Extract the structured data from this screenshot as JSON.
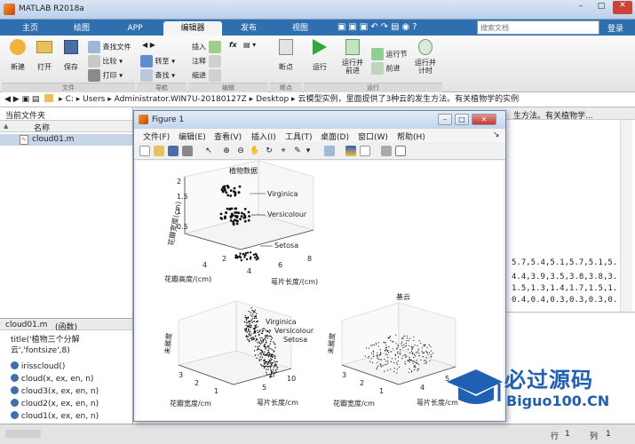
{
  "window": {
    "title": "MATLAB R2018a",
    "search_placeholder": "搜索文档",
    "login": "登录"
  },
  "tabs": [
    {
      "label": "主页"
    },
    {
      "label": "绘图"
    },
    {
      "label": "APP"
    },
    {
      "label": "编辑器"
    },
    {
      "label": "发布"
    },
    {
      "label": "视图"
    }
  ],
  "ribbon": {
    "new": "新建",
    "open": "打开",
    "save": "保存",
    "find_files": "查找文件",
    "compare": "比较",
    "print": "打印",
    "insert": "插入",
    "fx": "fx",
    "comment": "注释",
    "indent": "缩进",
    "goto": "转至",
    "find": "查找",
    "breakpoints": "断点",
    "run": "运行",
    "run_advance": "运行并\n前进",
    "run_section": "运行节",
    "advance": "前进",
    "run_time": "运行并\n计时",
    "groups": {
      "file": "文件",
      "navigate": "导航",
      "edit": "编辑",
      "breakpoints": "断点",
      "run": "运行"
    }
  },
  "address": {
    "parts": [
      "C:",
      "Users",
      "Administrator.WIN7U-20180127Z",
      "Desktop",
      "云模型实例，里面提供了3种云的发生方法。有关植物学的实例"
    ]
  },
  "current_folder": {
    "title": "当前文件夹",
    "col_name": "名称",
    "sort_icon": "▲",
    "file": "cloud01.m"
  },
  "details": {
    "filename": "cloud01.m",
    "kind": "(函数)",
    "lines": [
      "title('植物三个分解云','fontsize',8)",
      "irisscloud()",
      "cloud(x, ex, en, n)",
      "cloud3(x, ex, en, n)",
      "cloud2(x, ex, en, n)",
      "cloud1(x, ex, en, n)"
    ]
  },
  "command": {
    "right_text_1": "生方法。有关植物学...",
    "data_rows": [
      "5.7,5.4,5.1,5.7,5.1,5.",
      "4.4,3.9,3.5,3.8,3.8,3.",
      "1.5,1.3,1.4,1.7,1.5,1.",
      "0.4,0.4,0.3,0.3,0.3,0."
    ]
  },
  "status": {
    "row_label": "行",
    "row": "1",
    "col_label": "列",
    "col": "1"
  },
  "figure": {
    "title": "Figure 1",
    "menu": [
      "文件(F)",
      "编辑(E)",
      "查看(V)",
      "插入(I)",
      "工具(T)",
      "桌面(D)",
      "窗口(W)",
      "帮助(H)"
    ],
    "plots": {
      "top": {
        "title": "植物数据",
        "zlabel": "花瓣宽度(cm)",
        "xlabel": "花瓣高度/(cm)",
        "ylabel": "萼片长度/(cm)",
        "xticks": [
          "8",
          "6",
          "4"
        ],
        "yticks": [
          "4",
          "2"
        ],
        "zticks": [
          "2",
          "1.5",
          "1",
          "0.5"
        ],
        "labels": [
          "Virginica",
          "Versicolour",
          "Setosa"
        ]
      },
      "bl": {
        "zlabel": "未展度",
        "xlabel": "花瓣宽度/cm",
        "ylabel": "萼片长度/cm",
        "xticks": [
          "3",
          "2",
          "1"
        ],
        "yticks": [
          "5",
          "10"
        ],
        "labels": [
          "Virginica",
          "Versicolour",
          "Setosa"
        ]
      },
      "br": {
        "title": "基云",
        "zlabel": "未展度",
        "xlabel": "花瓣宽度/cm",
        "ylabel": "萼片长度/cm",
        "xticks": [
          "3",
          "2",
          "1"
        ],
        "yticks": [
          "4",
          "5"
        ]
      }
    }
  },
  "watermark": {
    "main": "必过源码",
    "sub": "Biguo100.CN"
  }
}
